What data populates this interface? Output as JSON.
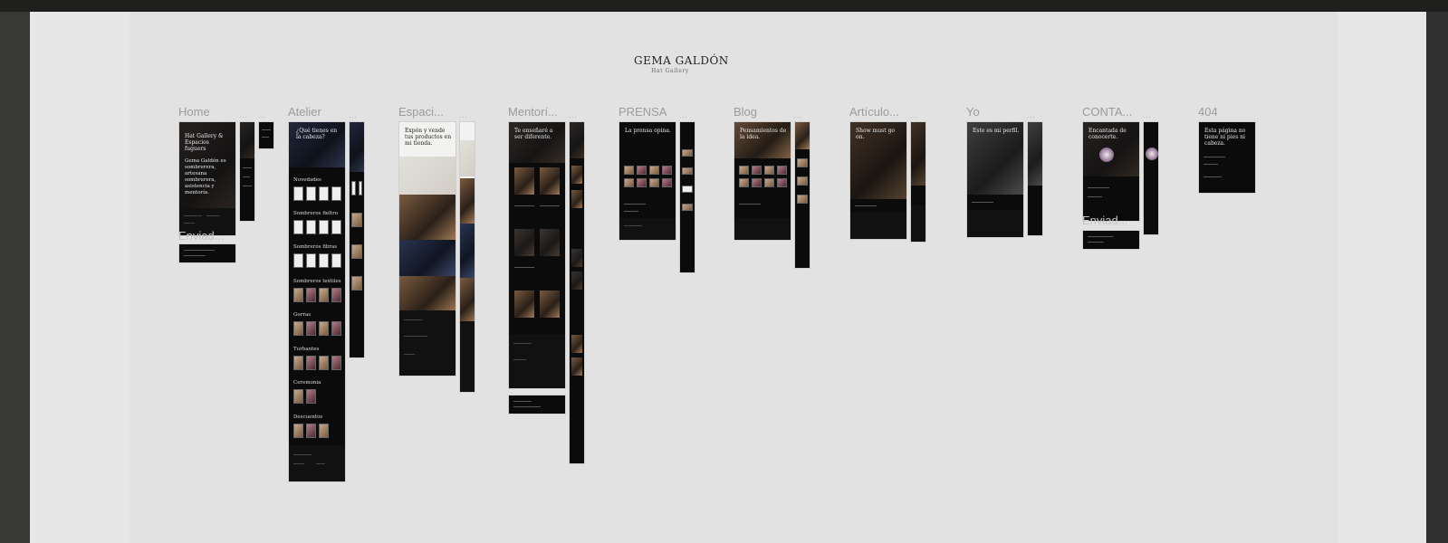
{
  "brand": {
    "name": "GEMA GALDÓN",
    "subtitle": "Hat Gallery"
  },
  "pages": [
    {
      "label": "Home",
      "title": "Hat Gallery & Espacios fuguers",
      "text": "Gema Galdón es sombrerera, artesana sombrerera, asistencia y mentoría.",
      "variant_label": "Enviad...",
      "dots": "..."
    },
    {
      "label": "Atelier",
      "title": "¿Qué tienes en la cabeza?",
      "sections": [
        "Novedades",
        "Sombreros fieltro",
        "Sombreros fibras",
        "Sombreros textiles",
        "Gorras",
        "Turbantes",
        "Ceremonia",
        "Descuentos"
      ],
      "dots": "..."
    },
    {
      "label": "Espaci...",
      "title": "Expón y vende tus productos en mi tienda.",
      "dots": "..."
    },
    {
      "label": "Mentorí...",
      "title": "Te enseñaré a ser diferente.",
      "dots": "..."
    },
    {
      "label": "PRENSA",
      "title": "La prensa opina.",
      "dots": "..."
    },
    {
      "label": "Blog",
      "title": "Pensamientos de la idea.",
      "dots": "..."
    },
    {
      "label": "Artículo...",
      "title": "Show must go on.",
      "dots": "..."
    },
    {
      "label": "Yo",
      "title": "Este es mi perfil.",
      "dots": "..."
    },
    {
      "label": "CONTA...",
      "title": "Encantada de conocerte.",
      "variant_label": "Enviad...",
      "dots": "..."
    },
    {
      "label": "404",
      "title": "Esta página no tiene ni pies ni cabeza."
    }
  ]
}
